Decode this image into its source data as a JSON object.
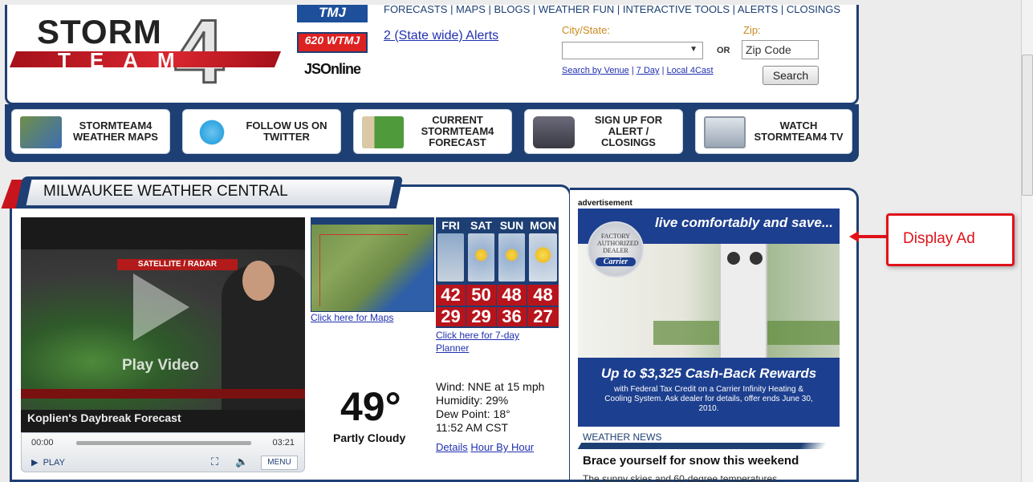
{
  "header": {
    "logo_word1": "STORM",
    "logo_word2": "TEAM",
    "logo_number": "4",
    "media_logos": [
      "TMJ",
      "620 WTMJ",
      "JSOnline"
    ],
    "top_nav": "FORECASTS | MAPS | BLOGS | WEATHER FUN | INTERACTIVE TOOLS | ALERTS | CLOSINGS",
    "alerts_link": "2 (State wide) Alerts",
    "city_label": "City/State:",
    "city_value": "",
    "or_label": "OR",
    "zip_label": "Zip:",
    "zip_placeholder": "Zip Code",
    "sublinks": [
      "Search by Venue",
      "7 Day",
      "Local 4Cast"
    ],
    "sublink_separator": " | ",
    "search_label": "Search"
  },
  "promo_buttons": [
    {
      "label": "STORMTEAM4 WEATHER MAPS",
      "icon": "weather-map-icon"
    },
    {
      "label": "FOLLOW US ON TWITTER",
      "icon": "twitter-bird-icon"
    },
    {
      "label": "CURRENT STORMTEAM4 FORECAST",
      "icon": "thermometer-map-icon"
    },
    {
      "label": "SIGN UP FOR ALERT / CLOSINGS",
      "icon": "sms-phone-icon"
    },
    {
      "label": "WATCH STORMTEAM4 TV",
      "icon": "tv-icon"
    }
  ],
  "main": {
    "title": "MILWAUKEE WEATHER CENTRAL",
    "video": {
      "overlay_tag": "SATELLITE / RADAR",
      "play_label": "Play Video",
      "title": "Koplien's Daybreak Forecast",
      "time_start": "00:00",
      "time_end": "03:21",
      "play_button": "PLAY",
      "menu_button": "MENU",
      "progress_fraction": 0
    },
    "maps_link": "Click here for Maps",
    "forecast": [
      {
        "day": "FRI",
        "hi": "42",
        "lo": "29",
        "sky": "cloudy"
      },
      {
        "day": "SAT",
        "hi": "50",
        "lo": "29",
        "sky": "partly-cloudy"
      },
      {
        "day": "SUN",
        "hi": "48",
        "lo": "36",
        "sky": "partly-cloudy"
      },
      {
        "day": "MON",
        "hi": "48",
        "lo": "27",
        "sky": "sunny"
      }
    ],
    "planner_link": "Click here for 7-day Planner",
    "current_temp": "49°",
    "condition": "Partly Cloudy",
    "wind": "Wind: NNE at 15 mph",
    "humidity": "Humidity: 29%",
    "dew_point": "Dew Point: 18°",
    "time": "11:52 AM CST",
    "details_link": "Details",
    "hour_link": "Hour By Hour"
  },
  "ad": {
    "label": "advertisement",
    "headline": "live comfortably and save...",
    "seal_text": "FACTORY AUTHORIZED DEALER",
    "seal_brand": "Carrier",
    "offer": "Up to $3,325 Cash-Back Rewards",
    "fine_print": "with Federal Tax Credit on a Carrier Infinity Heating & Cooling System. Ask dealer for details, offer ends June 30, 2010."
  },
  "news": {
    "label": "WEATHER NEWS",
    "headline": "Brace yourself for snow this weekend",
    "teaser": "The sunny skies and 60-degree temperatures"
  },
  "annotation": {
    "label": "Display Ad"
  },
  "colors": {
    "navy": "#1d3f73",
    "brand_red": "#c8141c",
    "link_blue": "#2030b0",
    "label_orange": "#c98a1e",
    "annotation_red": "#e0121a"
  }
}
